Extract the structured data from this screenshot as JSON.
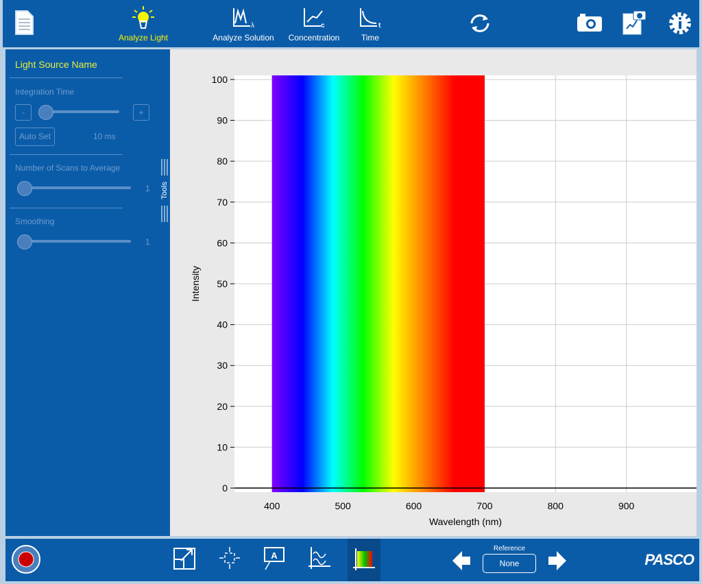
{
  "header": {
    "nav": [
      {
        "label": "Analyze Light",
        "icon": "lightbulb-icon",
        "active": true
      },
      {
        "label": "Analyze Solution",
        "icon": "absorbance-spectrum-icon"
      },
      {
        "label": "Concentration",
        "icon": "concentration-graph-icon"
      },
      {
        "label": "Time",
        "icon": "time-graph-icon"
      }
    ],
    "icons": [
      "document-icon",
      "refresh-icon",
      "camera-icon",
      "journal-snapshot-icon",
      "settings-info-icon"
    ]
  },
  "sidebar": {
    "title": "Light Source Name",
    "integration_time": {
      "label": "Integration Time",
      "minus": "-",
      "plus": "+",
      "auto_set": "Auto Set",
      "value": "10 ms",
      "slider_level": 0
    },
    "scans": {
      "label": "Number of Scans to Average",
      "value": "1"
    },
    "smoothing": {
      "label": "Smoothing",
      "value": "1"
    },
    "tools_tab": "Tools"
  },
  "chart_data": {
    "type": "area",
    "xlabel": "Wavelength (nm)",
    "ylabel": "Intensity",
    "xlim": [
      347,
      999
    ],
    "ylim": [
      -1,
      101
    ],
    "xticks": [
      400,
      500,
      600,
      700,
      800,
      900
    ],
    "yticks": [
      0,
      10,
      20,
      30,
      40,
      50,
      60,
      70,
      80,
      90,
      100
    ],
    "grid": true,
    "spectrum_band": {
      "x_start": 400,
      "x_end": 700,
      "y": [
        0,
        101
      ]
    },
    "spectrum_colors": [
      "#8000ff",
      "#0000ff",
      "#00ffff",
      "#00ff00",
      "#ffff00",
      "#ff8000",
      "#ff0000",
      "#ff0000"
    ]
  },
  "bottom": {
    "reference_label": "Reference",
    "reference_value": "None",
    "brand": "PASCO",
    "tools": [
      "scale-to-fit-icon",
      "crosshair-icon",
      "annotation-icon",
      "graph-overlay-icon",
      "spectrum-color-icon"
    ],
    "record_color": "#cc0000"
  }
}
